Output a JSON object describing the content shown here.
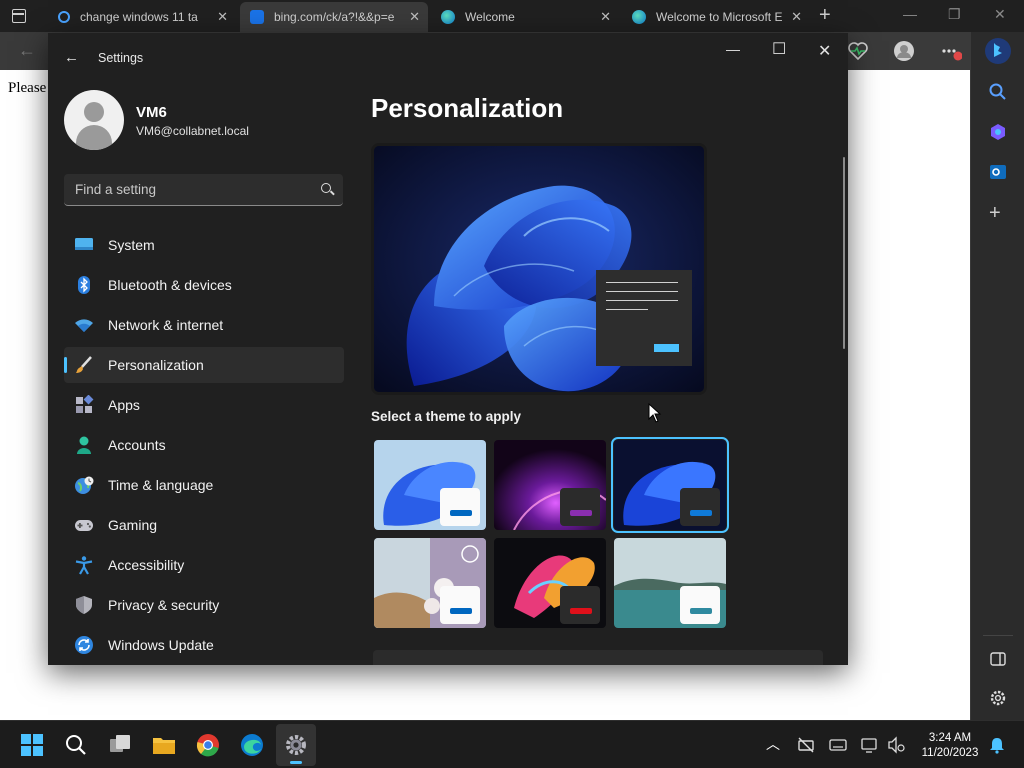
{
  "browser": {
    "tabs": [
      {
        "title": "change windows 11 ta"
      },
      {
        "title": "bing.com/ck/a?!&&p=e"
      },
      {
        "title": "Welcome"
      },
      {
        "title": "Welcome to Microsoft E"
      }
    ],
    "page_text": "Please"
  },
  "settings": {
    "window_title": "Settings",
    "user": {
      "name": "VM6",
      "email": "VM6@collabnet.local"
    },
    "search_placeholder": "Find a setting",
    "nav": [
      {
        "label": "System",
        "icon": "monitor-icon"
      },
      {
        "label": "Bluetooth & devices",
        "icon": "bluetooth-icon"
      },
      {
        "label": "Network & internet",
        "icon": "wifi-icon"
      },
      {
        "label": "Personalization",
        "icon": "brush-icon",
        "selected": true
      },
      {
        "label": "Apps",
        "icon": "apps-icon"
      },
      {
        "label": "Accounts",
        "icon": "person-icon"
      },
      {
        "label": "Time & language",
        "icon": "globe-clock-icon"
      },
      {
        "label": "Gaming",
        "icon": "gamepad-icon"
      },
      {
        "label": "Accessibility",
        "icon": "accessibility-icon"
      },
      {
        "label": "Privacy & security",
        "icon": "shield-icon"
      },
      {
        "label": "Windows Update",
        "icon": "update-icon"
      }
    ],
    "page_title": "Personalization",
    "theme_section_label": "Select a theme to apply",
    "themes": [
      {
        "name": "windows-light",
        "selected": false
      },
      {
        "name": "windows-glow",
        "selected": false
      },
      {
        "name": "windows-dark",
        "selected": true
      },
      {
        "name": "windows-spotlight",
        "selected": false
      },
      {
        "name": "captured-motion",
        "selected": false
      },
      {
        "name": "flow",
        "selected": false
      }
    ]
  },
  "taskbar": {
    "time": "3:24 AM",
    "date": "11/20/2023"
  },
  "colors": {
    "accent": "#4cc2ff",
    "settings_bg": "#202020",
    "taskbar_bg": "#1c1c1c"
  }
}
